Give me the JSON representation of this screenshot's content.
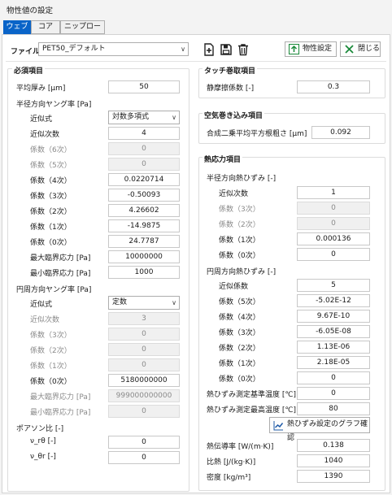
{
  "window": {
    "title": "物性値の設定"
  },
  "tabs": [
    {
      "label": "ウェブ"
    },
    {
      "label": "コア"
    },
    {
      "label": "ニップロール"
    }
  ],
  "toolbar": {
    "file_label": "ファイル",
    "file_value": "PET50_デフォルト",
    "property_settings": "物性設定",
    "close": "閉じる"
  },
  "required": {
    "title": "必須項目",
    "avg_thickness": {
      "label": "平均厚み [μm]",
      "value": "50"
    },
    "radial_young": {
      "title": "半径方向ヤング率 [Pa]",
      "approx": {
        "label": "近似式",
        "value": "対数多項式"
      },
      "order": {
        "label": "近似次数",
        "value": "4"
      },
      "c6": {
        "label": "係数（6次）",
        "value": "0"
      },
      "c5": {
        "label": "係数（5次）",
        "value": "0"
      },
      "c4": {
        "label": "係数（4次）",
        "value": "0.0220714"
      },
      "c3": {
        "label": "係数（3次）",
        "value": "-0.50093"
      },
      "c2": {
        "label": "係数（2次）",
        "value": "4.26602"
      },
      "c1": {
        "label": "係数（1次）",
        "value": "-14.9875"
      },
      "c0": {
        "label": "係数（0次）",
        "value": "24.7787"
      },
      "max_stress": {
        "label": "最大臨界応力 [Pa]",
        "value": "10000000"
      },
      "min_stress": {
        "label": "最小臨界応力 [Pa]",
        "value": "1000"
      }
    },
    "circ_young": {
      "title": "円周方向ヤング率 [Pa]",
      "approx": {
        "label": "近似式",
        "value": "定数"
      },
      "order": {
        "label": "近似次数",
        "value": "3"
      },
      "c3": {
        "label": "係数（3次）",
        "value": "0"
      },
      "c2": {
        "label": "係数（2次）",
        "value": "0"
      },
      "c1": {
        "label": "係数（1次）",
        "value": "0"
      },
      "c0": {
        "label": "係数（0次）",
        "value": "5180000000"
      },
      "max_stress": {
        "label": "最大臨界応力 [Pa]",
        "value": "999000000000"
      },
      "min_stress": {
        "label": "最小臨界応力 [Pa]",
        "value": "0"
      }
    },
    "poisson": {
      "title": "ポアソン比 [-]",
      "vrt": {
        "label": "ν_rθ [-]",
        "value": "0"
      },
      "vtr": {
        "label": "ν_θr [-]",
        "value": "0"
      }
    }
  },
  "touch": {
    "title": "タッチ巻取項目",
    "friction": {
      "label": "静摩擦係数 [-]",
      "value": "0.3"
    }
  },
  "air": {
    "title": "空気巻き込み項目",
    "roughness": {
      "label": "合成二乗平均平方根粗さ [μm]",
      "value": "0.092"
    }
  },
  "thermal": {
    "title": "熱応力項目",
    "radial": {
      "title": "半径方向熱ひずみ [-]",
      "order": {
        "label": "近似次数",
        "value": "1"
      },
      "c3": {
        "label": "係数（3次）",
        "value": "0"
      },
      "c2": {
        "label": "係数（2次）",
        "value": "0"
      },
      "c1": {
        "label": "係数（1次）",
        "value": "0.000136"
      },
      "c0": {
        "label": "係数（0次）",
        "value": "0"
      }
    },
    "circ": {
      "title": "円周方向熱ひずみ [-]",
      "order": {
        "label": "近似係数",
        "value": "5"
      },
      "c5": {
        "label": "係数（5次）",
        "value": "-5.02E-12"
      },
      "c4": {
        "label": "係数（4次）",
        "value": "9.67E-10"
      },
      "c3": {
        "label": "係数（3次）",
        "value": "-6.05E-08"
      },
      "c2": {
        "label": "係数（2次）",
        "value": "1.13E-06"
      },
      "c1": {
        "label": "係数（1次）",
        "value": "2.18E-05"
      },
      "c0": {
        "label": "係数（0次）",
        "value": "0"
      }
    },
    "ref_temp": {
      "label": "熱ひずみ測定基準温度 [℃]",
      "value": "0"
    },
    "max_temp": {
      "label": "熱ひずみ測定最高温度 [℃]",
      "value": "80"
    },
    "graph_button": "熱ひずみ設定のグラフ確認",
    "conductivity": {
      "label": "熱伝導率 [W/(m·K)]",
      "value": "0.138"
    },
    "specific_heat": {
      "label": "比熱 [J/(kg·K)]",
      "value": "1040"
    },
    "density": {
      "label": "密度 [kg/m³]",
      "value": "1390"
    }
  }
}
